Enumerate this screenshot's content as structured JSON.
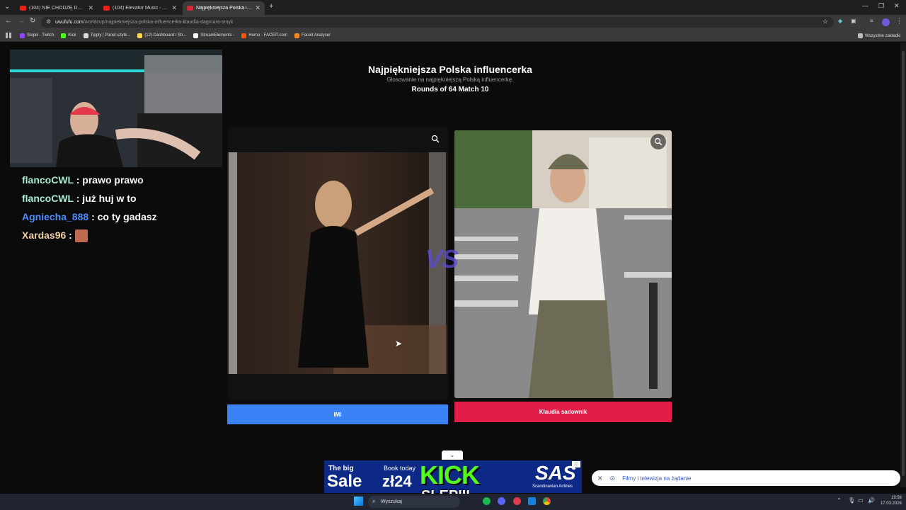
{
  "browser": {
    "tabs": [
      {
        "label": "(104) NIE CHODZĘ DO SZKOŁY",
        "active": false
      },
      {
        "label": "(104) Elevator Music - Gam",
        "active": false
      },
      {
        "label": "Najpiękniejsza Polska influencer",
        "active": true
      }
    ],
    "new_tab": "+",
    "url_host": "uwufufu.com",
    "url_path": "/worldcup/najpiekniejsza-polska-influencerka-klaudia-dagmara-smyk",
    "bookmarks": [
      "Slepiii - Twitch",
      "Kick",
      "Tipply | Panel użytk...",
      "(12) Dashboard / Str...",
      "StreamElements -",
      "Home - FACEIT.com",
      "Faceit Analyser"
    ],
    "all_bookmarks": "Wszystkie zakładki"
  },
  "page": {
    "title": "Najpiękniejsza Polska influencerka",
    "subtitle": "Głosowanie na najpiękniejszą Polską influencerkę.",
    "round": "Rounds of 64 Match 10",
    "vs": "VS",
    "left": {
      "name": "IMI",
      "color": "#3b82f6"
    },
    "right": {
      "name": "Klaudia sadownik",
      "color": "#e11d48"
    }
  },
  "chat": [
    {
      "user": "flancoCWL",
      "user_color": "#a8f0d8",
      "message": ": prawo prawo"
    },
    {
      "user": "flancoCWL",
      "user_color": "#a8f0d8",
      "message": ": już huj w to"
    },
    {
      "user": "Agniecha_888",
      "user_color": "#4a90ff",
      "message": ": co ty gadasz"
    },
    {
      "user": "Xardas96",
      "user_color": "#f0d0a0",
      "message": ":"
    }
  ],
  "ad": {
    "line1": "The big",
    "line2": "Sale",
    "book": "Book today",
    "price": "zł24",
    "brand": "SAS",
    "brand_sub": "Scandinavian Airlines",
    "overlay_kick": "KICK",
    "overlay_name": "SLEPIII"
  },
  "notification": "Filmy i telewizja na żądanie",
  "taskbar": {
    "search": "Wyszukaj",
    "time": "19:56",
    "date": "17.03.2026"
  }
}
